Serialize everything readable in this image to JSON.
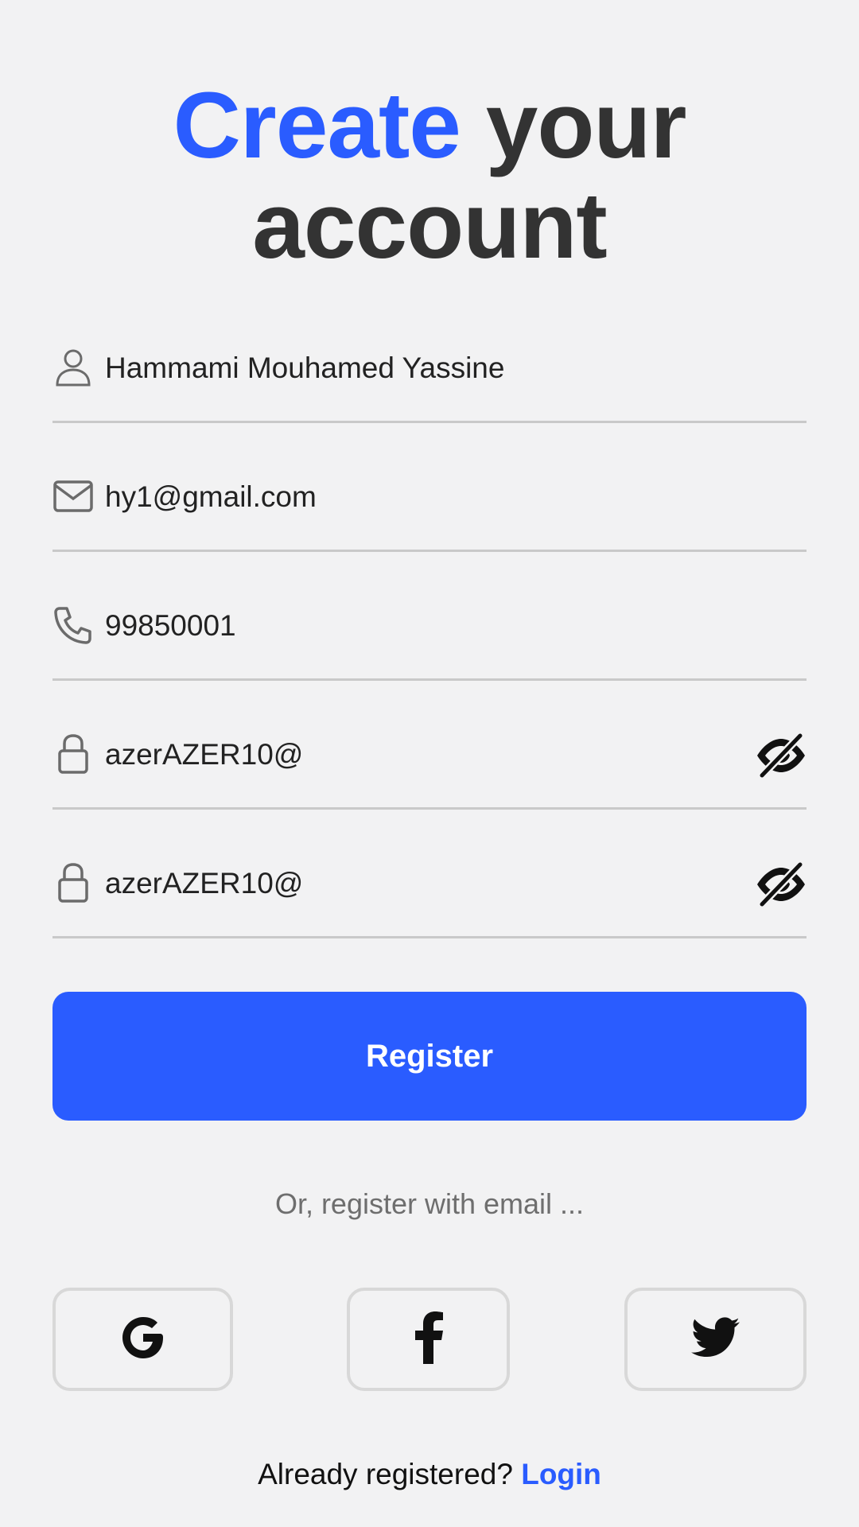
{
  "header": {
    "title_accent": "Create",
    "title_rest_line1": "your",
    "title_line2": "account"
  },
  "form": {
    "name": {
      "value": "Hammami Mouhamed Yassine",
      "icon": "user-icon"
    },
    "email": {
      "value": "hy1@gmail.com",
      "icon": "mail-icon"
    },
    "phone": {
      "value": "99850001",
      "icon": "phone-icon"
    },
    "password": {
      "value": "azerAZER10@",
      "icon": "lock-icon",
      "toggle_icon": "eye-off-icon"
    },
    "confirm_password": {
      "value": "azerAZER10@",
      "icon": "lock-icon",
      "toggle_icon": "eye-off-icon"
    }
  },
  "actions": {
    "register_label": "Register",
    "alt_text": "Or, register with email ...",
    "social": [
      "google-icon",
      "facebook-icon",
      "twitter-icon"
    ]
  },
  "footer": {
    "prompt": "Already registered?",
    "login_label": "Login"
  },
  "colors": {
    "accent": "#2a5cff",
    "background": "#f2f2f3",
    "title": "#333333"
  }
}
